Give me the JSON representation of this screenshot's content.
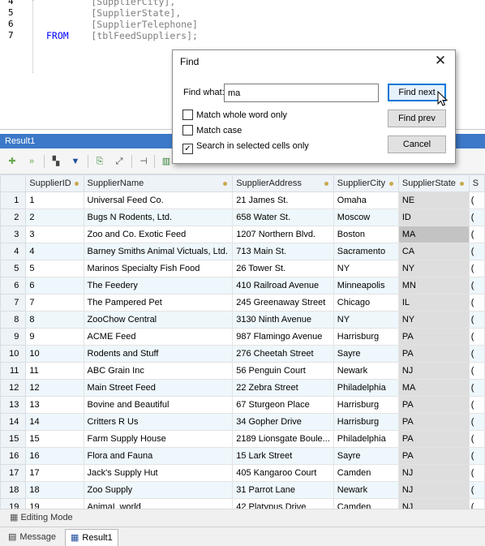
{
  "editor": {
    "lines": [
      {
        "num": "4",
        "code": "        [SupplierCity],"
      },
      {
        "num": "5",
        "code": "        [SupplierState],"
      },
      {
        "num": "6",
        "code": "        [SupplierTelephone]"
      },
      {
        "num": "7",
        "keyword": "FROM",
        "code": "    [tblFeedSuppliers];"
      }
    ]
  },
  "result": {
    "title": "Result1",
    "toolbar_commit": "Commit"
  },
  "grid": {
    "columns": [
      "SupplierID",
      "SupplierName",
      "SupplierAddress",
      "SupplierCity",
      "SupplierState",
      "S"
    ],
    "rows": [
      [
        "1",
        "1",
        "Universal Feed Co.",
        "21 James St.",
        "Omaha",
        "NE",
        "("
      ],
      [
        "2",
        "2",
        "Bugs N Rodents, Ltd.",
        "658 Water St.",
        "Moscow",
        "ID",
        "("
      ],
      [
        "3",
        "3",
        "Zoo and Co. Exotic Feed",
        "1207 Northern Blvd.",
        "Boston",
        "MA",
        "("
      ],
      [
        "4",
        "4",
        "Barney Smiths Animal Victuals, Ltd.",
        "713 Main St.",
        "Sacramento",
        "CA",
        "("
      ],
      [
        "5",
        "5",
        "Marinos Specialty Fish Food",
        "26 Tower St.",
        "NY",
        "NY",
        "("
      ],
      [
        "6",
        "6",
        "The Feedery",
        "410 Railroad Avenue",
        "Minneapolis",
        "MN",
        "("
      ],
      [
        "7",
        "7",
        "The Pampered Pet",
        "245 Greenaway Street",
        "Chicago",
        "IL",
        "("
      ],
      [
        "8",
        "8",
        "ZooChow Central",
        "3130 Ninth Avenue",
        "NY",
        "NY",
        "("
      ],
      [
        "9",
        "9",
        "ACME Feed",
        "987 Flamingo Avenue",
        "Harrisburg",
        "PA",
        "("
      ],
      [
        "10",
        "10",
        "Rodents and Stuff",
        "276 Cheetah Street",
        "Sayre",
        "PA",
        "("
      ],
      [
        "11",
        "11",
        "ABC Grain Inc",
        "56 Penguin Court",
        "Newark",
        "NJ",
        "("
      ],
      [
        "12",
        "12",
        "Main Street Feed",
        "22 Zebra Street",
        "Philadelphia",
        "MA",
        "("
      ],
      [
        "13",
        "13",
        "Bovine and Beautiful",
        "67 Sturgeon Place",
        "Harrisburg",
        "PA",
        "("
      ],
      [
        "14",
        "14",
        "Critters R Us",
        "34 Gopher Drive",
        "Harrisburg",
        "PA",
        "("
      ],
      [
        "15",
        "15",
        "Farm Supply House",
        "2189 Lionsgate Boule...",
        "Philadelphia",
        "PA",
        "("
      ],
      [
        "16",
        "16",
        "Flora and Fauna",
        "15 Lark Street",
        "Sayre",
        "PA",
        "("
      ],
      [
        "17",
        "17",
        "Jack's Supply Hut",
        "405 Kangaroo Court",
        "Camden",
        "NJ",
        "("
      ],
      [
        "18",
        "18",
        "Zoo Supply",
        "31 Parrot Lane",
        "Newark",
        "NJ",
        "("
      ],
      [
        "19",
        "19",
        "AnimaL world",
        "42 Platypus Drive",
        "Camden",
        "NJ",
        "("
      ]
    ]
  },
  "status": {
    "editing_mode": "Editing Mode"
  },
  "tabs": [
    {
      "label": "Message"
    },
    {
      "label": "Result1"
    }
  ],
  "find": {
    "title": "Find",
    "find_what_label": "Find what:",
    "find_what_value": "ma",
    "match_whole_word": {
      "label": "Match whole word only",
      "checked": false
    },
    "match_case": {
      "label": "Match case",
      "checked": false
    },
    "search_selected": {
      "label": "Search in selected cells only",
      "checked": true
    },
    "find_next": "Find next",
    "find_prev": "Find prev",
    "cancel": "Cancel"
  },
  "colors": {
    "result_header": "#3c79c8",
    "selected_cell": "#c3c3c3",
    "state_column": "#dedede"
  }
}
